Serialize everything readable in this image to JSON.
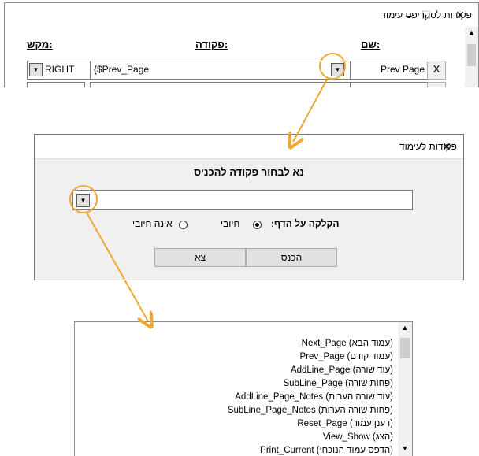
{
  "script_window": {
    "title": "פקודות לסקריפט עימוד",
    "headers": {
      "name": ":שם",
      "command": ":פקודה",
      "key": ":מקש"
    },
    "row": {
      "key_value": "RIGHT",
      "command_value": "{$Prev_Page",
      "name_value": "Prev Page",
      "remove_label": "X"
    },
    "controls": {
      "minimize": "–",
      "maximize": "☐",
      "close": "✕"
    }
  },
  "command_dialog": {
    "title": "פקודות לעימוד",
    "prompt": "נא לבחור פקודה להכניס",
    "combo_value": "",
    "click_label": "הקלקה על הדף:",
    "radio_required": "חיובי",
    "radio_not_required": "אינה חיובי",
    "insert_button": "הכנס",
    "exit_button": "צא",
    "close": "✕"
  },
  "dropdown_items": [
    "Next_Page (עמוד הבא)",
    "Prev_Page (עמוד קודם)",
    "AddLine_Page (עוד שורה)",
    "SubLine_Page (פחות שורה)",
    "AddLine_Page_Notes (עוד שורה הערות)",
    "SubLine_Page_Notes (פחות שורה הערות)",
    "Reset_Page (רענן עמוד)",
    "View_Show (הצג)",
    "Print_Current (הדפס עמוד הנוכחי)"
  ],
  "colors": {
    "accent": "#f0a830",
    "dialog_bg": "#f0f0f0"
  },
  "icons": {
    "dropdown": "chevron-down-icon",
    "scroll_up": "chevron-up-icon",
    "scroll_down": "chevron-down-icon"
  }
}
